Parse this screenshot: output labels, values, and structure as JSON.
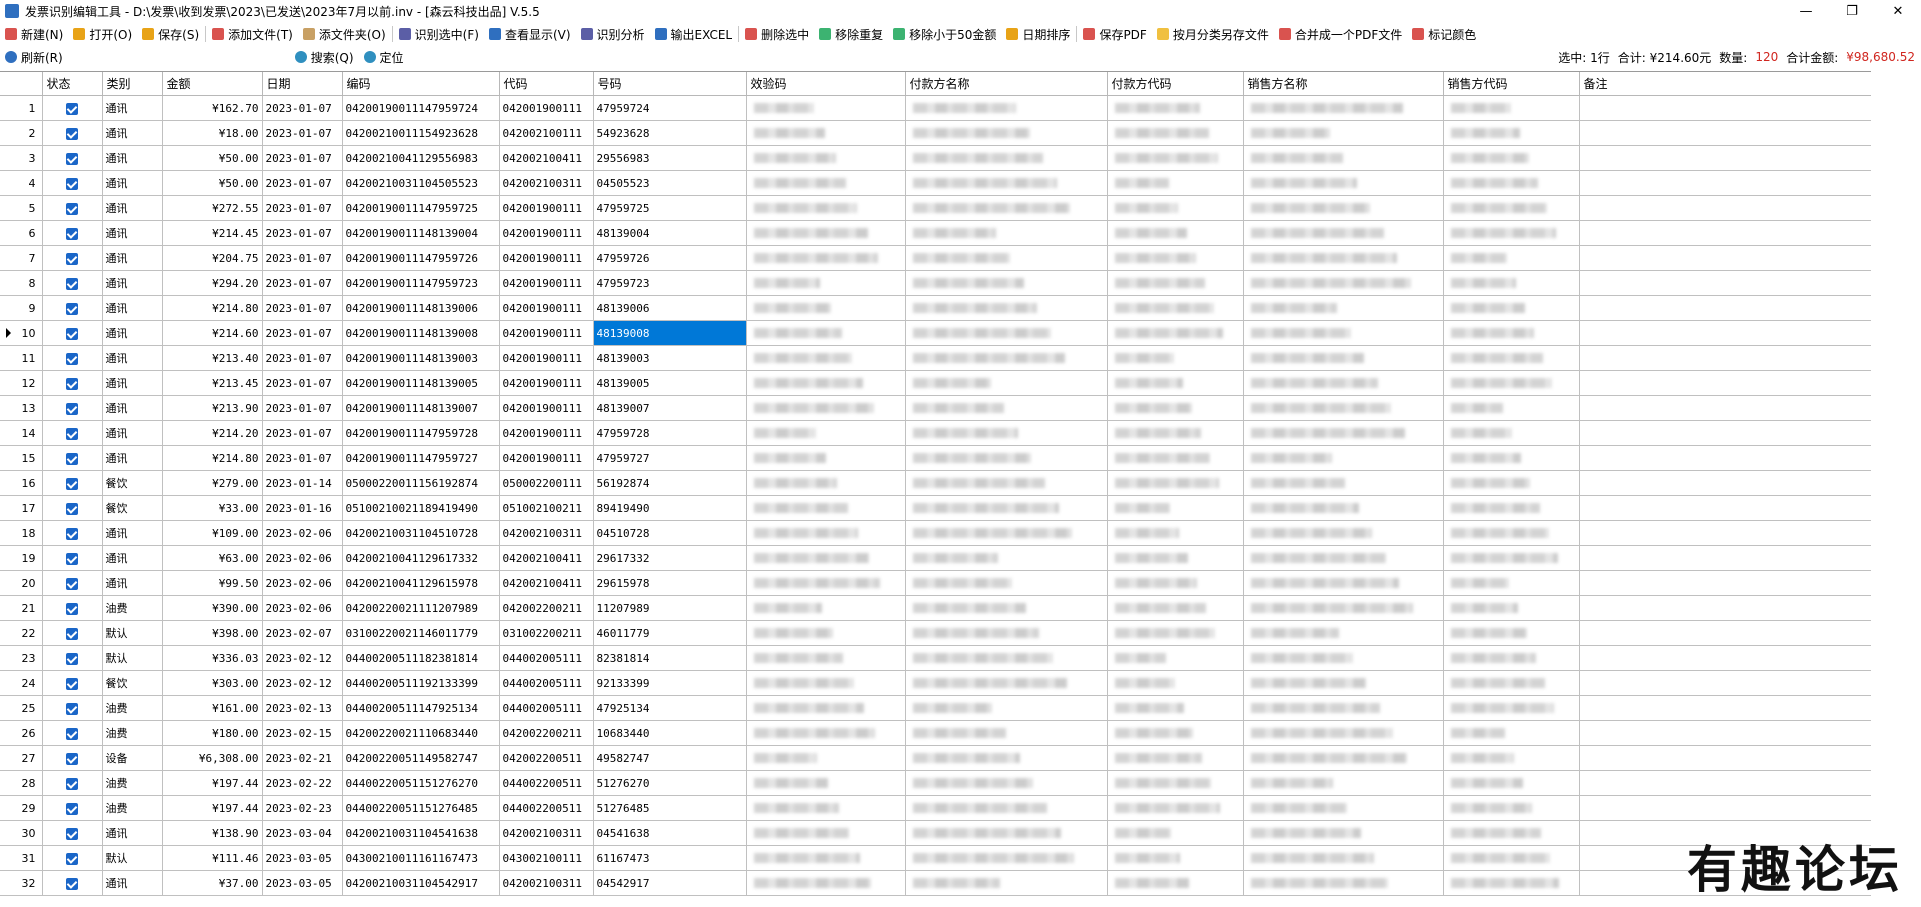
{
  "window": {
    "title": "发票识别编辑工具 - D:\\发票\\收到发票\\2023\\已发送\\2023年7月以前.inv - [森云科技出品] V.5.5"
  },
  "toolbar": {
    "items": [
      {
        "label": "新建(N)",
        "icon": "new-icon",
        "color": "#d9534f"
      },
      {
        "label": "打开(O)",
        "icon": "open-folder-icon",
        "color": "#e8a317"
      },
      {
        "label": "保存(S)",
        "icon": "save-icon",
        "color": "#e8a317"
      },
      {
        "label": "添加文件(T)",
        "icon": "add-file-icon",
        "color": "#d9534f"
      },
      {
        "label": "添文件夹(O)",
        "icon": "add-folder-icon",
        "color": "#c8a064"
      },
      {
        "label": "识别选中(F)",
        "icon": "recognize-icon",
        "color": "#5b5ea6"
      },
      {
        "label": "查看显示(V)",
        "icon": "view-icon",
        "color": "#2f6fbf"
      },
      {
        "label": "识别分析",
        "icon": "analyze-icon",
        "color": "#5b5ea6"
      },
      {
        "label": "输出EXCEL",
        "icon": "excel-icon",
        "color": "#2f6fbf"
      },
      {
        "label": "删除选中",
        "icon": "delete-icon",
        "color": "#d9534f"
      },
      {
        "label": "移除重复",
        "icon": "remove-duplicate-icon",
        "color": "#3cb371"
      },
      {
        "label": "移除小于50金额",
        "icon": "remove-small-icon",
        "color": "#3cb371"
      },
      {
        "label": "日期排序",
        "icon": "sort-date-icon",
        "color": "#e8a317"
      },
      {
        "label": "保存PDF",
        "icon": "pdf-icon",
        "color": "#d9534f"
      },
      {
        "label": "按月分类另存文件",
        "icon": "folder-icon",
        "color": "#f0c040"
      },
      {
        "label": "合并成一个PDF文件",
        "icon": "merge-pdf-icon",
        "color": "#d9534f"
      },
      {
        "label": "标记颜色",
        "icon": "color-mark-icon",
        "color": "#d9534f"
      }
    ]
  },
  "toolbar2": {
    "refresh": "刷新(R)",
    "search": "搜索(Q)",
    "locate": "定位"
  },
  "status": {
    "selected": "选中: 1行",
    "total": "合计: ¥214.60元",
    "count_label": "数量:",
    "count": "120",
    "sum_label": "合计金额:",
    "sum": "¥98,680.52"
  },
  "table": {
    "headers": [
      "",
      "状态",
      "类别",
      "金额",
      "日期",
      "编码",
      "代码",
      "号码",
      "效验码",
      "付款方名称",
      "付款方代码",
      "销售方名称",
      "销售方代码",
      "备注"
    ],
    "selected_row": 10,
    "rows": [
      {
        "n": "1",
        "cat": "通讯",
        "amt": "¥162.70",
        "date": "2023-01-07",
        "code": "04200190011147959724",
        "dm": "042001900111",
        "hm": "47959724"
      },
      {
        "n": "2",
        "cat": "通讯",
        "amt": "¥18.00",
        "date": "2023-01-07",
        "code": "04200210011154923628",
        "dm": "042002100111",
        "hm": "54923628"
      },
      {
        "n": "3",
        "cat": "通讯",
        "amt": "¥50.00",
        "date": "2023-01-07",
        "code": "04200210041129556983",
        "dm": "042002100411",
        "hm": "29556983"
      },
      {
        "n": "4",
        "cat": "通讯",
        "amt": "¥50.00",
        "date": "2023-01-07",
        "code": "04200210031104505523",
        "dm": "042002100311",
        "hm": "04505523"
      },
      {
        "n": "5",
        "cat": "通讯",
        "amt": "¥272.55",
        "date": "2023-01-07",
        "code": "04200190011147959725",
        "dm": "042001900111",
        "hm": "47959725"
      },
      {
        "n": "6",
        "cat": "通讯",
        "amt": "¥214.45",
        "date": "2023-01-07",
        "code": "04200190011148139004",
        "dm": "042001900111",
        "hm": "48139004"
      },
      {
        "n": "7",
        "cat": "通讯",
        "amt": "¥204.75",
        "date": "2023-01-07",
        "code": "04200190011147959726",
        "dm": "042001900111",
        "hm": "47959726"
      },
      {
        "n": "8",
        "cat": "通讯",
        "amt": "¥294.20",
        "date": "2023-01-07",
        "code": "04200190011147959723",
        "dm": "042001900111",
        "hm": "47959723"
      },
      {
        "n": "9",
        "cat": "通讯",
        "amt": "¥214.80",
        "date": "2023-01-07",
        "code": "04200190011148139006",
        "dm": "042001900111",
        "hm": "48139006"
      },
      {
        "n": "10",
        "cat": "通讯",
        "amt": "¥214.60",
        "date": "2023-01-07",
        "code": "04200190011148139008",
        "dm": "042001900111",
        "hm": "48139008"
      },
      {
        "n": "11",
        "cat": "通讯",
        "amt": "¥213.40",
        "date": "2023-01-07",
        "code": "04200190011148139003",
        "dm": "042001900111",
        "hm": "48139003"
      },
      {
        "n": "12",
        "cat": "通讯",
        "amt": "¥213.45",
        "date": "2023-01-07",
        "code": "04200190011148139005",
        "dm": "042001900111",
        "hm": "48139005"
      },
      {
        "n": "13",
        "cat": "通讯",
        "amt": "¥213.90",
        "date": "2023-01-07",
        "code": "04200190011148139007",
        "dm": "042001900111",
        "hm": "48139007"
      },
      {
        "n": "14",
        "cat": "通讯",
        "amt": "¥214.20",
        "date": "2023-01-07",
        "code": "04200190011147959728",
        "dm": "042001900111",
        "hm": "47959728"
      },
      {
        "n": "15",
        "cat": "通讯",
        "amt": "¥214.80",
        "date": "2023-01-07",
        "code": "04200190011147959727",
        "dm": "042001900111",
        "hm": "47959727"
      },
      {
        "n": "16",
        "cat": "餐饮",
        "amt": "¥279.00",
        "date": "2023-01-14",
        "code": "05000220011156192874",
        "dm": "050002200111",
        "hm": "56192874"
      },
      {
        "n": "17",
        "cat": "餐饮",
        "amt": "¥33.00",
        "date": "2023-01-16",
        "code": "05100210021189419490",
        "dm": "051002100211",
        "hm": "89419490"
      },
      {
        "n": "18",
        "cat": "通讯",
        "amt": "¥109.00",
        "date": "2023-02-06",
        "code": "04200210031104510728",
        "dm": "042002100311",
        "hm": "04510728"
      },
      {
        "n": "19",
        "cat": "通讯",
        "amt": "¥63.00",
        "date": "2023-02-06",
        "code": "04200210041129617332",
        "dm": "042002100411",
        "hm": "29617332"
      },
      {
        "n": "20",
        "cat": "通讯",
        "amt": "¥99.50",
        "date": "2023-02-06",
        "code": "04200210041129615978",
        "dm": "042002100411",
        "hm": "29615978"
      },
      {
        "n": "21",
        "cat": "油费",
        "amt": "¥390.00",
        "date": "2023-02-06",
        "code": "04200220021111207989",
        "dm": "042002200211",
        "hm": "11207989"
      },
      {
        "n": "22",
        "cat": "默认",
        "amt": "¥398.00",
        "date": "2023-02-07",
        "code": "03100220021146011779",
        "dm": "031002200211",
        "hm": "46011779"
      },
      {
        "n": "23",
        "cat": "默认",
        "amt": "¥336.03",
        "date": "2023-02-12",
        "code": "04400200511182381814",
        "dm": "044002005111",
        "hm": "82381814"
      },
      {
        "n": "24",
        "cat": "餐饮",
        "amt": "¥303.00",
        "date": "2023-02-12",
        "code": "04400200511192133399",
        "dm": "044002005111",
        "hm": "92133399"
      },
      {
        "n": "25",
        "cat": "油费",
        "amt": "¥161.00",
        "date": "2023-02-13",
        "code": "04400200511147925134",
        "dm": "044002005111",
        "hm": "47925134"
      },
      {
        "n": "26",
        "cat": "油费",
        "amt": "¥180.00",
        "date": "2023-02-15",
        "code": "04200220021110683440",
        "dm": "042002200211",
        "hm": "10683440"
      },
      {
        "n": "27",
        "cat": "设备",
        "amt": "¥6,308.00",
        "date": "2023-02-21",
        "code": "04200220051149582747",
        "dm": "042002200511",
        "hm": "49582747"
      },
      {
        "n": "28",
        "cat": "油费",
        "amt": "¥197.44",
        "date": "2023-02-22",
        "code": "04400220051151276270",
        "dm": "044002200511",
        "hm": "51276270"
      },
      {
        "n": "29",
        "cat": "油费",
        "amt": "¥197.44",
        "date": "2023-02-23",
        "code": "04400220051151276485",
        "dm": "044002200511",
        "hm": "51276485"
      },
      {
        "n": "30",
        "cat": "通讯",
        "amt": "¥138.90",
        "date": "2023-03-04",
        "code": "04200210031104541638",
        "dm": "042002100311",
        "hm": "04541638"
      },
      {
        "n": "31",
        "cat": "默认",
        "amt": "¥111.46",
        "date": "2023-03-05",
        "code": "04300210011161167473",
        "dm": "043002100111",
        "hm": "61167473"
      },
      {
        "n": "32",
        "cat": "通讯",
        "amt": "¥37.00",
        "date": "2023-03-05",
        "code": "04200210031104542917",
        "dm": "042002100311",
        "hm": "04542917"
      }
    ]
  },
  "watermark": "有趣论坛"
}
